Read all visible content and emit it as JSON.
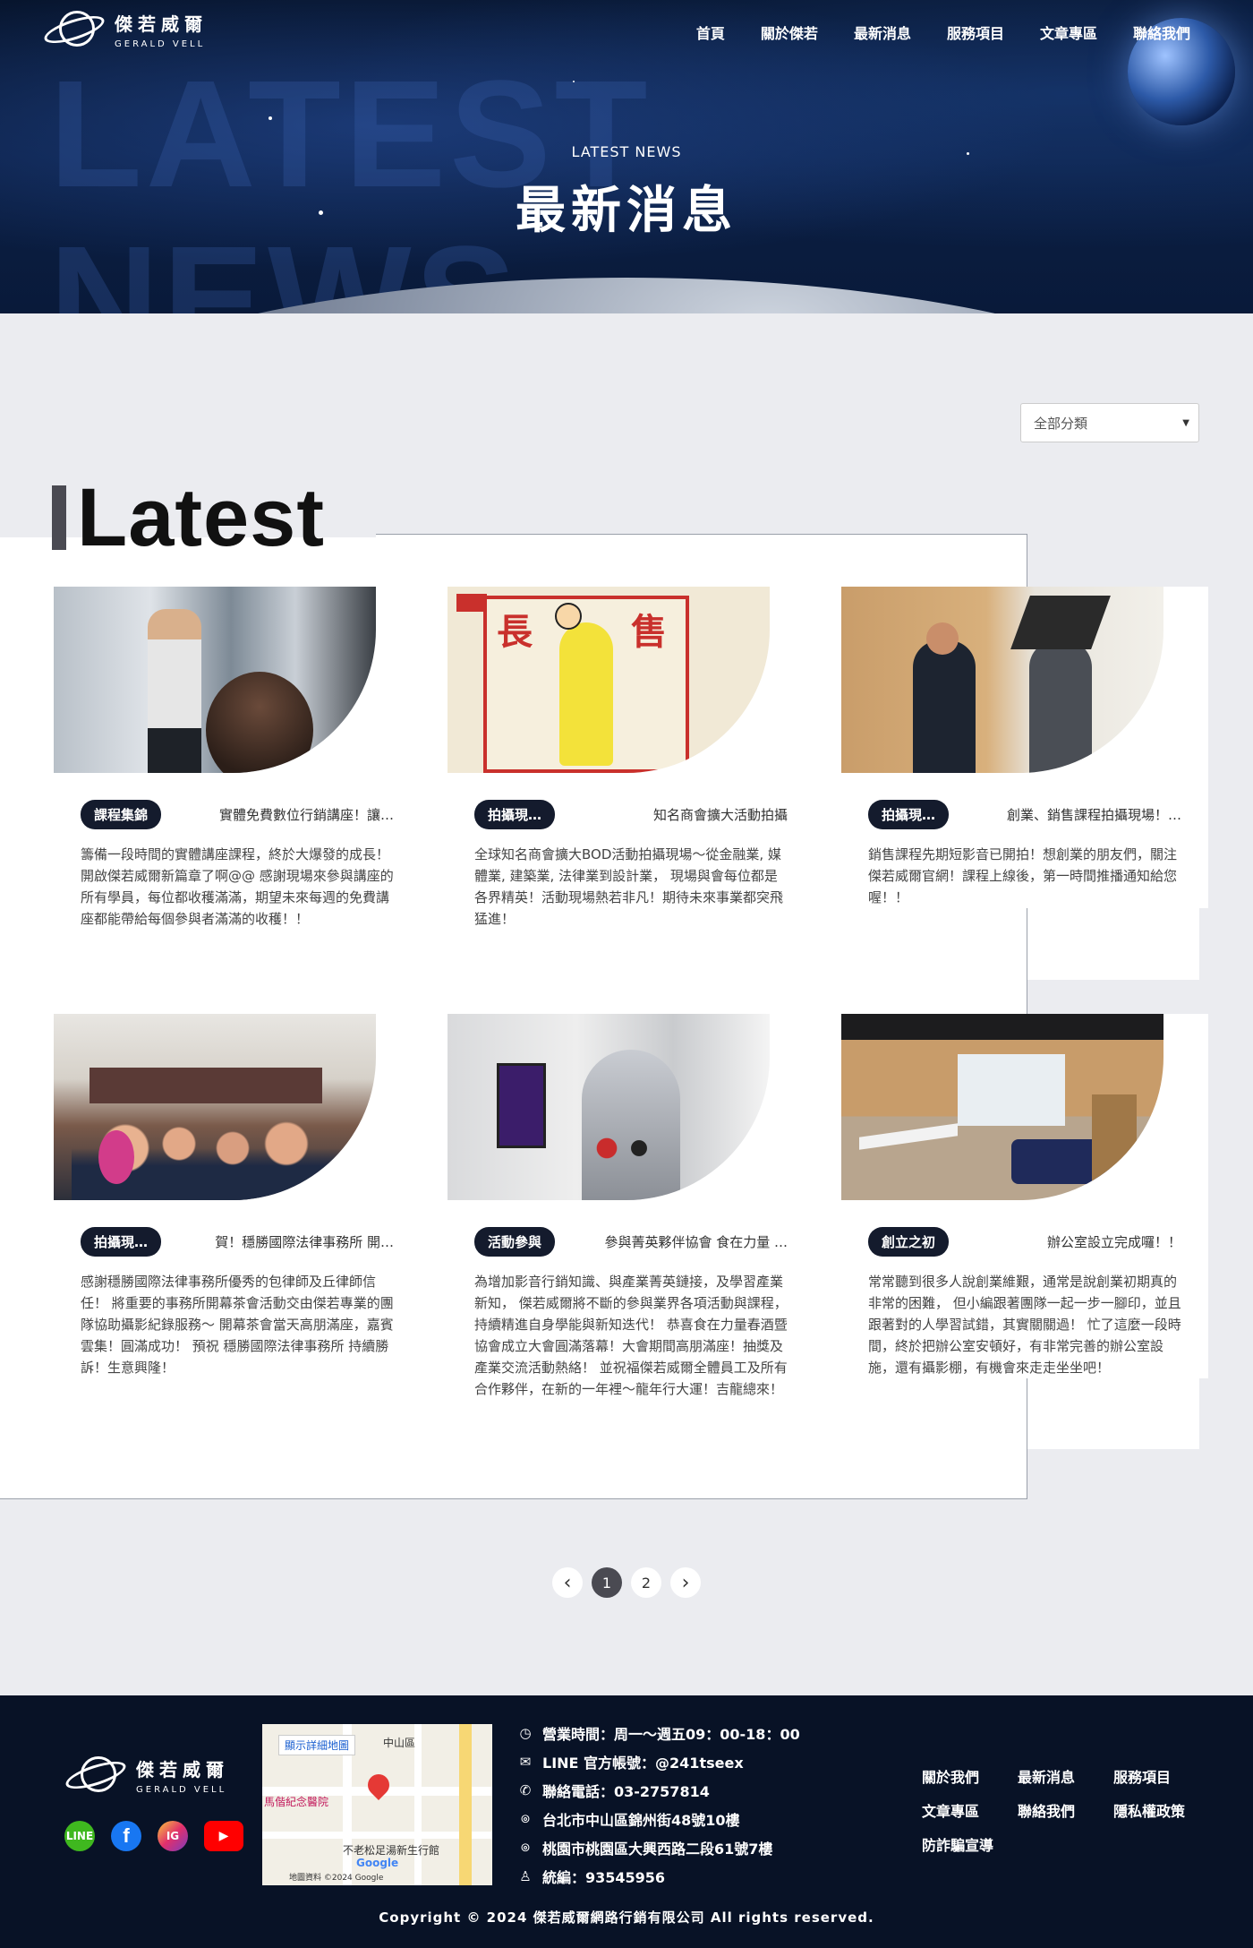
{
  "header": {
    "logo_zh": "傑若威爾",
    "logo_en": "GERALD VELL",
    "nav": [
      "首頁",
      "關於傑若",
      "最新消息",
      "服務項目",
      "文章專區",
      "聯絡我們"
    ]
  },
  "hero": {
    "bg_word_1": "LATEST",
    "bg_word_2": "NEWS",
    "subtitle": "LATEST NEWS",
    "title": "最新消息"
  },
  "filter": {
    "selected": "全部分類"
  },
  "section_title": "Latest",
  "cards": [
    {
      "tag": "課程集錦",
      "title": "實體免費數位行銷講座！讓…",
      "body": "籌備一段時間的實體講座課程，終於大爆發的成長！開啟傑若威爾新篇章了啊@@ 感謝現場來參與講座的所有學員，每位都收穫滿滿，期望未來每週的免費講座都能帶給每個參與者滿滿的收穫！！"
    },
    {
      "tag": "拍攝現…",
      "title": "知名商會擴大活動拍攝",
      "body": "全球知名商會擴大BOD活動拍攝現場～從金融業, 媒體業, 建築業, 法律業到設計業， 現場與會每位都是各界精英！活動現場熱若非凡！期待未來事業都突飛猛進！"
    },
    {
      "tag": "拍攝現…",
      "title": "創業、銷售課程拍攝現場！…",
      "body": "銷售課程先期短影音已開拍！想創業的朋友們，關注傑若威爾官網！課程上線後，第一時間推播通知給您喔！！"
    },
    {
      "tag": "拍攝現…",
      "title": "賀！穩勝國際法律事務所 開…",
      "body": "感謝穩勝國際法律事務所優秀的包律師及丘律師信任！ 將重要的事務所開幕茶會活動交由傑若專業的團隊協助攝影紀錄服務～ 開幕茶會當天高朋滿座，嘉賓雲集！圓滿成功！ 預祝 穩勝國際法律事務所 持續勝訴！生意興隆！"
    },
    {
      "tag": "活動參與",
      "title": "參與菁英夥伴協會 食在力量 …",
      "body": "為增加影音行銷知識、與產業菁英鏈接，及學習產業新知， 傑若威爾將不斷的參與業界各項活動與課程，持續精進自身學能與新知迭代！ 恭喜食在力量春酒暨協會成立大會圓滿落幕！大會期間高朋滿座！抽獎及產業交流活動熱絡！ 並祝福傑若威爾全體員工及所有合作夥伴，在新的一年裡～龍年行大運！吉龍總來！"
    },
    {
      "tag": "創立之初",
      "title": "辦公室設立完成囉！！",
      "body": "常常聽到很多人說創業維艱，通常是說創業初期真的非常的困難， 但小編跟著團隊一起一步一腳印，並且跟著對的人學習試錯，其實關關過！ 忙了這麼一段時間，終於把辦公室安頓好，有非常完善的辦公室設施，還有攝影棚，有機會來走走坐坐吧！"
    }
  ],
  "pagination": {
    "prev": "‹",
    "pages": [
      "1",
      "2"
    ],
    "next": "›"
  },
  "footer": {
    "logo_zh": "傑若威爾",
    "logo_en": "GERALD VELL",
    "socials": [
      "LINE",
      "f",
      "IG",
      "▶"
    ],
    "map": {
      "button": "顯示詳細地圖",
      "labels": [
        "中山區",
        "馬偕紀念醫院",
        "不老松足湯新生行館",
        "Google",
        "地圖資料 ©2024 Google"
      ]
    },
    "info": [
      {
        "icon": "clock-icon",
        "text": "營業時間：周一～週五09：00-18：00"
      },
      {
        "icon": "mail-icon",
        "text": "LINE 官方帳號：@241tseex"
      },
      {
        "icon": "phone-icon",
        "text": "聯絡電話：03-2757814"
      },
      {
        "icon": "location-icon",
        "text": "台北市中山區錦州街48號10樓"
      },
      {
        "icon": "location-icon",
        "text": "桃園市桃園區大興西路二段61號7樓"
      },
      {
        "icon": "user-icon",
        "text": "統編：93545956"
      }
    ],
    "links": [
      "關於我們",
      "最新消息",
      "服務項目",
      "文章專區",
      "聯絡我們",
      "隱私權政策",
      "防詐騙宣導"
    ],
    "copyright": "Copyright © 2024 傑若威爾網路行銷有限公司 All rights reserved."
  }
}
